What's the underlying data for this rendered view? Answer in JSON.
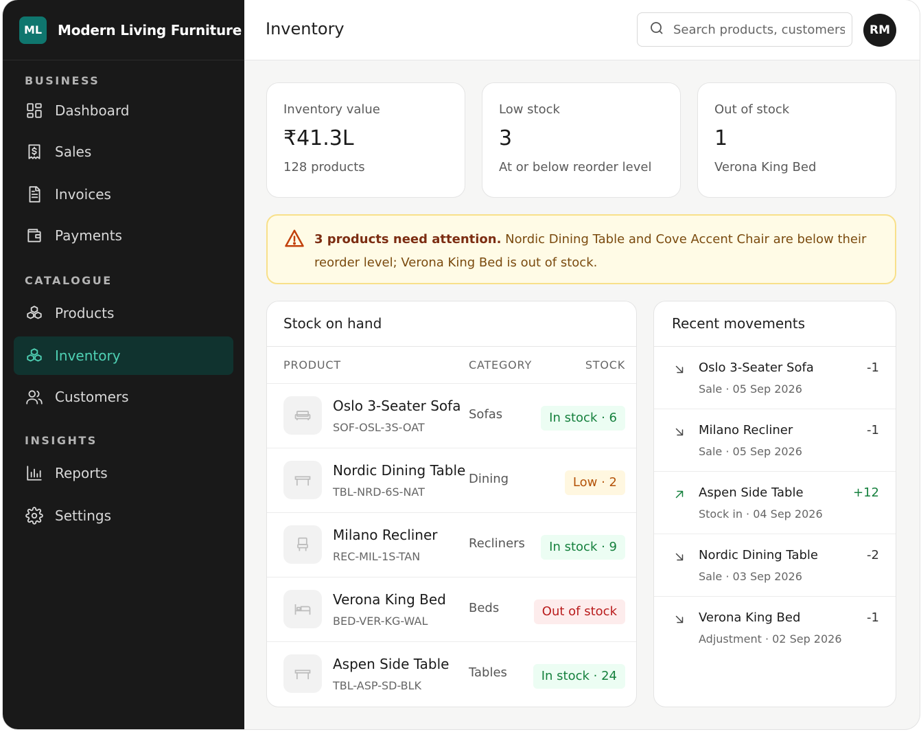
{
  "brand": {
    "logo": "ML",
    "name": "Modern Living Furniture"
  },
  "sidebar": {
    "sections": [
      {
        "label": "BUSINESS"
      },
      {
        "label": "CATALOGUE"
      },
      {
        "label": "INSIGHTS"
      }
    ],
    "items": [
      {
        "label": "Dashboard",
        "icon": "grid-icon"
      },
      {
        "label": "Sales",
        "icon": "receipt-dollar-icon"
      },
      {
        "label": "Invoices",
        "icon": "document-icon"
      },
      {
        "label": "Payments",
        "icon": "wallet-icon"
      },
      {
        "label": "Products",
        "icon": "boxes-icon"
      },
      {
        "label": "Inventory",
        "icon": "boxes-icon",
        "active": true
      },
      {
        "label": "Customers",
        "icon": "users-icon"
      },
      {
        "label": "Reports",
        "icon": "bar-chart-icon"
      },
      {
        "label": "Settings",
        "icon": "gear-icon"
      }
    ]
  },
  "header": {
    "title": "Inventory",
    "search_placeholder": "Search products, customers",
    "avatar": "RM"
  },
  "stats": [
    {
      "label": "Inventory value",
      "value": "₹41.3L",
      "sub": "128 products"
    },
    {
      "label": "Low stock",
      "value": "3",
      "sub": "At or below reorder level"
    },
    {
      "label": "Out of stock",
      "value": "1",
      "sub": "Verona King Bed"
    }
  ],
  "alert": {
    "bold": "3 products need attention.",
    "text": "Nordic Dining Table and Cove Accent Chair are below their reorder level; Verona King Bed is out of stock."
  },
  "stock": {
    "title": "Stock on hand",
    "columns": [
      "PRODUCT",
      "CATEGORY",
      "STOCK"
    ],
    "rows": [
      {
        "name": "Oslo 3-Seater Sofa",
        "sku": "SOF-OSL-3S-OAT",
        "category": "Sofas",
        "status": "In stock · 6",
        "level": "ok"
      },
      {
        "name": "Nordic Dining Table",
        "sku": "TBL-NRD-6S-NAT",
        "category": "Dining",
        "status": "Low · 2",
        "level": "low"
      },
      {
        "name": "Milano Recliner",
        "sku": "REC-MIL-1S-TAN",
        "category": "Recliners",
        "status": "In stock · 9",
        "level": "ok"
      },
      {
        "name": "Verona King Bed",
        "sku": "BED-VER-KG-WAL",
        "category": "Beds",
        "status": "Out of stock",
        "level": "out"
      },
      {
        "name": "Aspen Side Table",
        "sku": "TBL-ASP-SD-BLK",
        "category": "Tables",
        "status": "In stock · 24",
        "level": "ok"
      }
    ]
  },
  "movements": {
    "title": "Recent movements",
    "rows": [
      {
        "name": "Oslo 3-Seater Sofa",
        "meta": "Sale · 05 Sep 2026",
        "qty": "-1",
        "direction": "out"
      },
      {
        "name": "Milano Recliner",
        "meta": "Sale · 05 Sep 2026",
        "qty": "-1",
        "direction": "out"
      },
      {
        "name": "Aspen Side Table",
        "meta": "Stock in · 04 Sep 2026",
        "qty": "+12",
        "direction": "in"
      },
      {
        "name": "Nordic Dining Table",
        "meta": "Sale · 03 Sep 2026",
        "qty": "-2",
        "direction": "out"
      },
      {
        "name": "Verona King Bed",
        "meta": "Adjustment · 02 Sep 2026",
        "qty": "-1",
        "direction": "out"
      }
    ]
  },
  "colors": {
    "sidebar_bg": "#191919",
    "accent": "#0f766e",
    "active_text": "#4fd1b4",
    "ok": "#15803d",
    "low": "#b45309",
    "out": "#b91c1c",
    "alert_bg": "#fffbe6"
  }
}
